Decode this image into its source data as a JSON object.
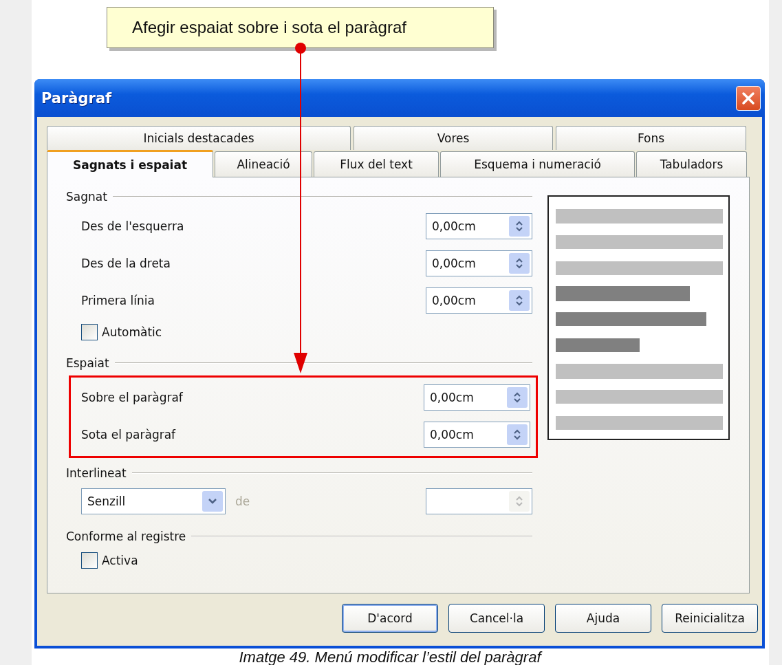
{
  "callout": {
    "text": "Afegir espaiat sobre i sota el paràgraf"
  },
  "window": {
    "title": "Paràgraf"
  },
  "tab_rows": [
    {
      "tabs": [
        {
          "label": "Inicials destacades",
          "selected": false
        },
        {
          "label": "Vores",
          "selected": false
        },
        {
          "label": "Fons",
          "selected": false
        }
      ]
    },
    {
      "tabs": [
        {
          "label": "Sagnats i espaiat",
          "selected": true
        },
        {
          "label": "Alineació",
          "selected": false
        },
        {
          "label": "Flux del text",
          "selected": false
        },
        {
          "label": "Esquema i numeració",
          "selected": false
        },
        {
          "label": "Tabuladors",
          "selected": false
        }
      ]
    }
  ],
  "sections": [
    {
      "title": "Sagnat",
      "highlighted": false,
      "items": [
        {
          "kind": "spin",
          "label": "Des de l'esquerra",
          "value": "0,00cm"
        },
        {
          "kind": "spin",
          "label": "Des de la dreta",
          "value": "0,00cm"
        },
        {
          "kind": "spin",
          "label": "Primera línia",
          "value": "0,00cm"
        },
        {
          "kind": "checkbox",
          "label": "Automàtic",
          "checked": false
        }
      ]
    },
    {
      "title": "Espaiat",
      "highlighted": true,
      "items": [
        {
          "kind": "spin",
          "label": "Sobre el paràgraf",
          "value": "0,00cm"
        },
        {
          "kind": "spin",
          "label": "Sota el paràgraf",
          "value": "0,00cm"
        }
      ]
    },
    {
      "title": "Interlineat",
      "highlighted": false,
      "items": [
        {
          "kind": "select",
          "value": "Senzill",
          "label": "de",
          "disabled": true
        }
      ]
    },
    {
      "title": "Conforme al registre",
      "highlighted": false,
      "items": [
        {
          "kind": "checkbox",
          "label": "Activa",
          "checked": false
        }
      ]
    }
  ],
  "buttons": [
    {
      "label": "D'acord",
      "default": true
    },
    {
      "label": "Cancel·la",
      "default": false
    },
    {
      "label": "Ajuda",
      "default": false
    },
    {
      "label": "Reinicialitza",
      "default": false
    }
  ],
  "caption": "Imatge 49. Menú modificar l’estil del paràgraf"
}
